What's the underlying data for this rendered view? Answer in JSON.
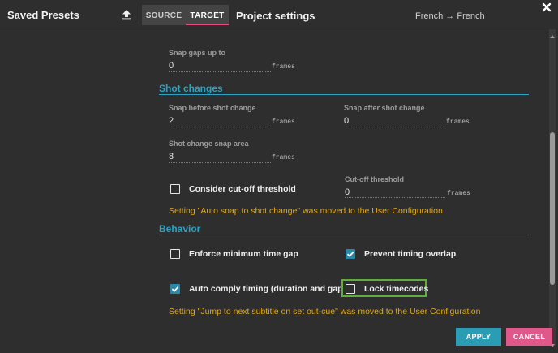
{
  "header": {
    "presets_title": "Saved Presets",
    "upload_icon": "upload-icon",
    "tabs": [
      {
        "label": "SOURCE"
      },
      {
        "label": "TARGET"
      }
    ],
    "active_tab": "TARGET",
    "settings_title": "Project settings",
    "language_pair": "French → French",
    "close_icon": "close-icon"
  },
  "snap_gaps": {
    "label": "Snap gaps up to",
    "value": "0",
    "unit": "frames"
  },
  "shot_changes": {
    "title": "Shot changes",
    "snap_before": {
      "label": "Snap before shot change",
      "value": "2",
      "unit": "frames"
    },
    "snap_after": {
      "label": "Snap after shot change",
      "value": "0",
      "unit": "frames"
    },
    "snap_area": {
      "label": "Shot change snap area",
      "value": "8",
      "unit": "frames"
    },
    "cutoff_checkbox": {
      "label": "Consider cut-off threshold",
      "checked": false
    },
    "cutoff_threshold": {
      "label": "Cut-off threshold",
      "value": "0",
      "unit": "frames"
    },
    "notice": "Setting \"Auto snap to shot change\" was moved to the User Configuration"
  },
  "behavior": {
    "title": "Behavior",
    "enforce_gap": {
      "label": "Enforce minimum time gap",
      "checked": false
    },
    "prevent_overlap": {
      "label": "Prevent timing overlap",
      "checked": true
    },
    "auto_comply": {
      "label": "Auto comply timing (duration and gap)",
      "checked": true
    },
    "lock_timecodes": {
      "label": "Lock timecodes",
      "checked": false
    },
    "notice": "Setting \"Jump to next subtitle on set out-cue\" was moved to the User Configuration"
  },
  "footer": {
    "apply_label": "APPLY",
    "cancel_label": "CANCEL"
  },
  "colors": {
    "accent": "#2aa3c4",
    "tab_underline": "#e84a82",
    "warning": "#e0a81a",
    "apply": "#2a9db5",
    "cancel": "#e0588a",
    "focus": "#5fae3d"
  }
}
